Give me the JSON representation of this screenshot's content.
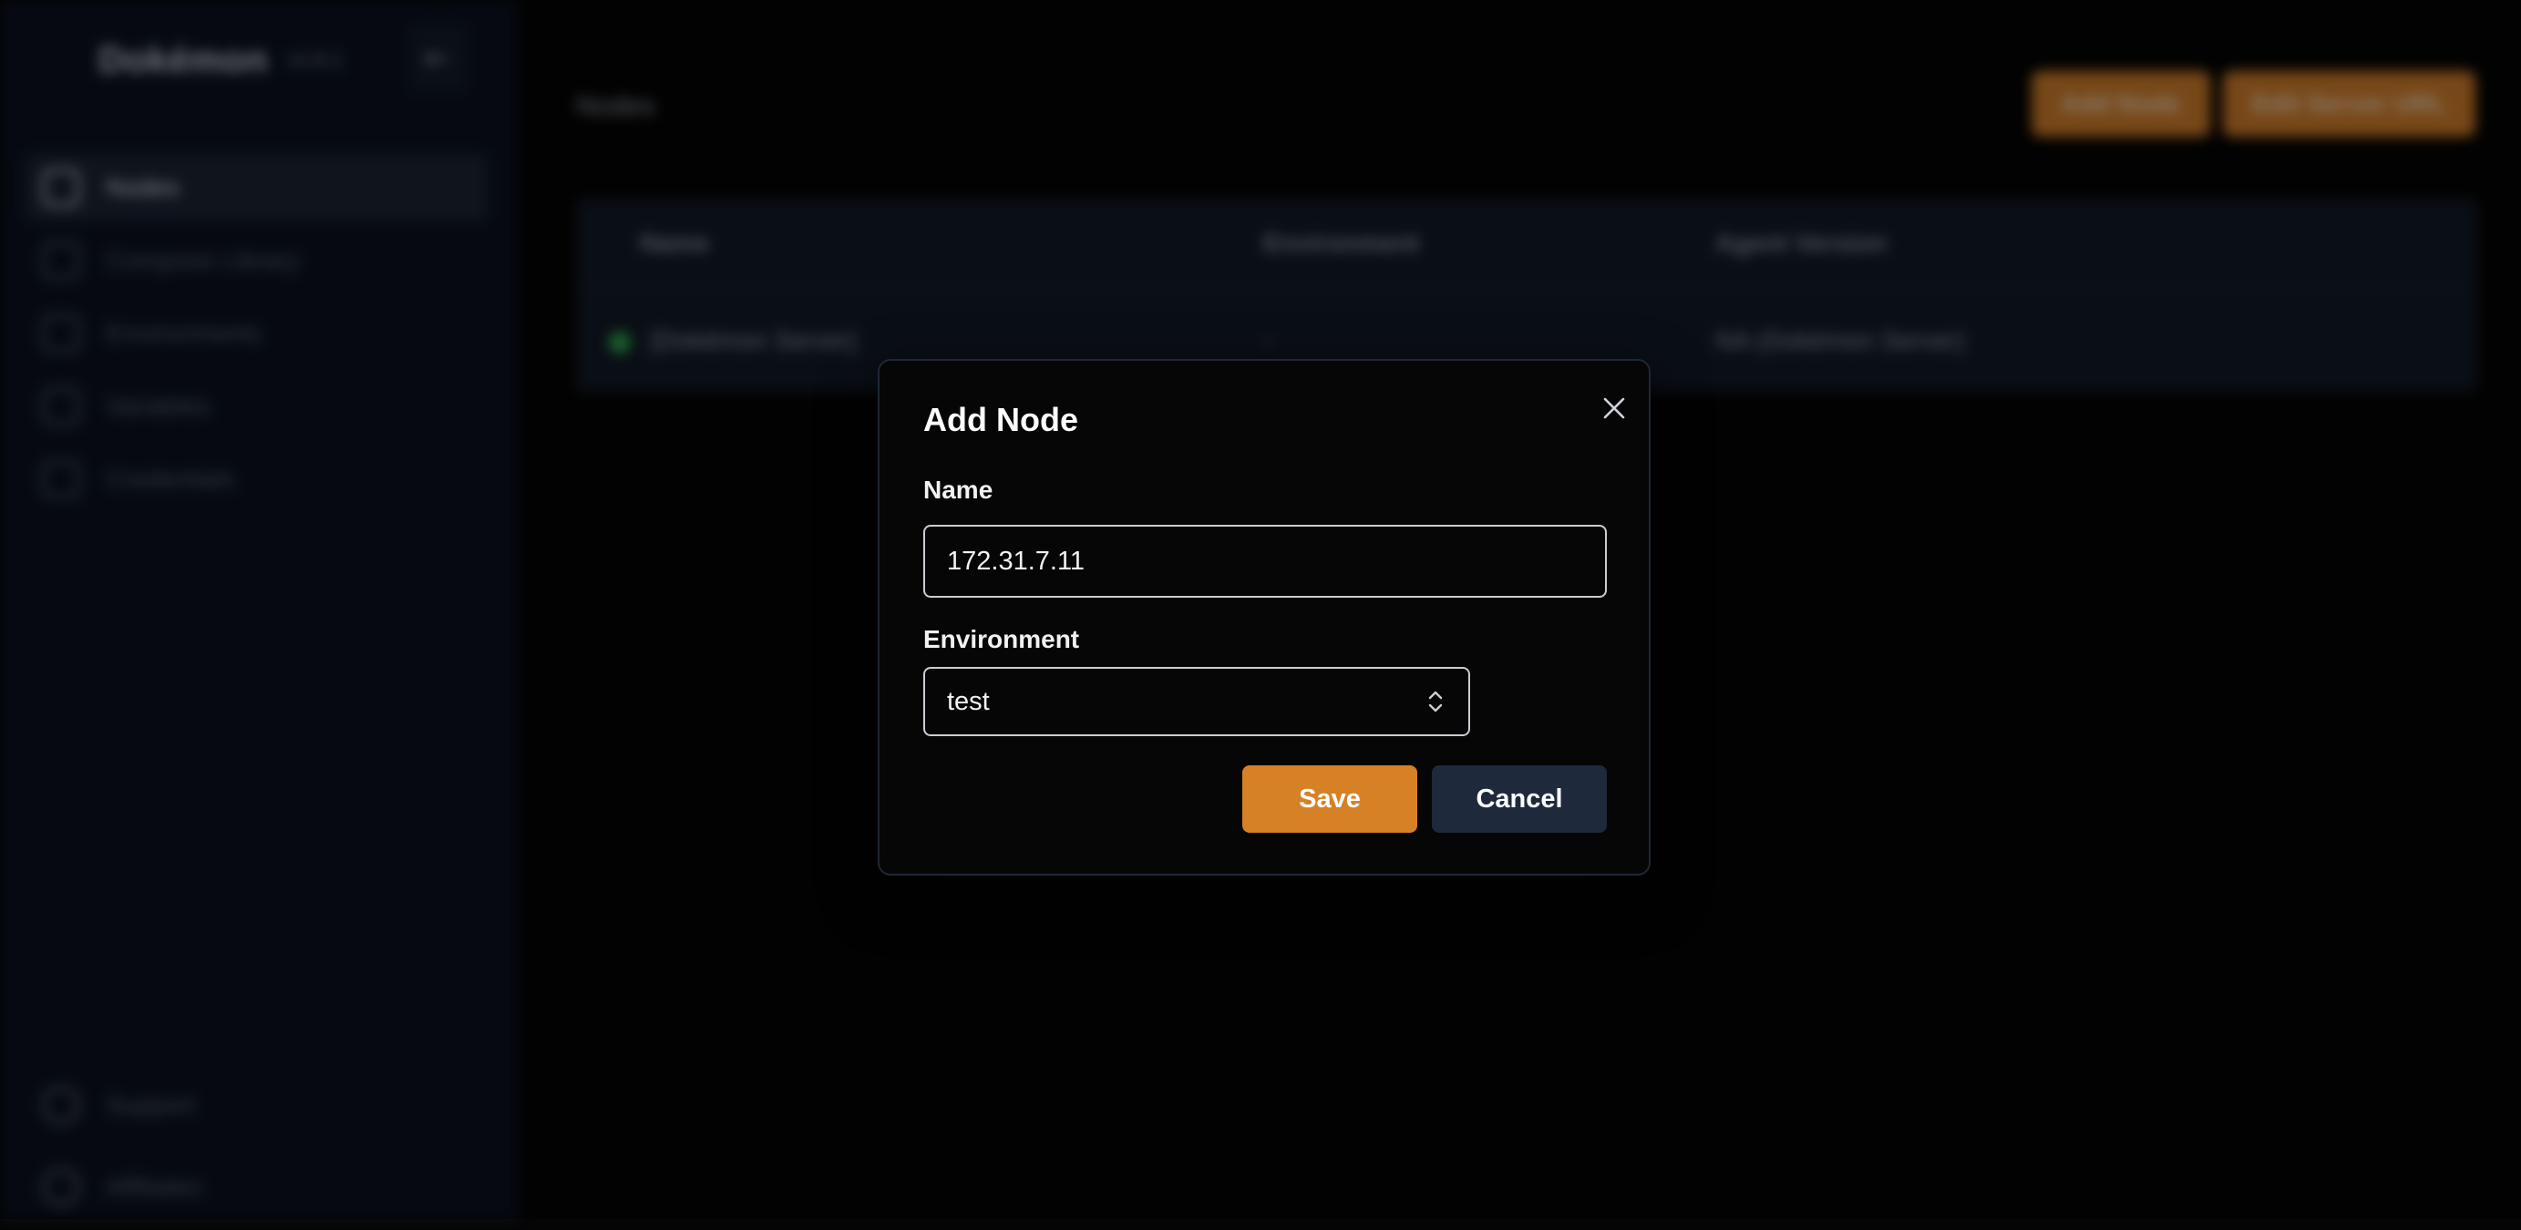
{
  "app": {
    "brand_name": "Dokémon",
    "brand_version": "v1.6.1"
  },
  "sidebar": {
    "items": [
      {
        "label": "Nodes",
        "icon": "server-icon",
        "active": true
      },
      {
        "label": "Compose Library",
        "icon": "compose-icon",
        "active": false
      },
      {
        "label": "Environments",
        "icon": "environment-icon",
        "active": false
      },
      {
        "label": "Variables",
        "icon": "variable-icon",
        "active": false
      },
      {
        "label": "Credentials",
        "icon": "lock-icon",
        "active": false
      }
    ],
    "bottom_items": [
      {
        "label": "Support",
        "icon": "support-icon"
      },
      {
        "label": "Affiliates",
        "icon": "affiliate-icon"
      }
    ]
  },
  "main": {
    "title": "Nodes",
    "actions": {
      "add_node": "Add Node",
      "edit_server_url": "Edit Server URL"
    },
    "table": {
      "columns": [
        "Name",
        "Environment",
        "Agent Version"
      ],
      "rows": [
        {
          "name": "[Dokémon Server]",
          "environment": "-",
          "agent_version": "NA (Dokémon Server)",
          "status": "online"
        }
      ]
    }
  },
  "modal": {
    "title": "Add Node",
    "name_label": "Name",
    "name_value": "172.31.7.11",
    "environment_label": "Environment",
    "environment_value": "test",
    "save_label": "Save",
    "cancel_label": "Cancel"
  },
  "colors": {
    "accent": "#d68125",
    "cancel_bg": "#1e293b",
    "status_online": "#2fb24f"
  }
}
